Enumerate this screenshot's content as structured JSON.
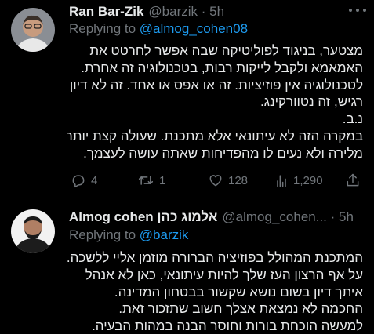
{
  "tweet1": {
    "author_name": "Ran Bar-Zik",
    "author_handle": "@barzik · 5h",
    "replying_prefix": "Replying to ",
    "replying_to": "@almog_cohen08",
    "lines": [
      "מצטער, בניגוד לפוליטיקה שבה אפשר לחרטט את",
      "האמאמא ולקבל לייקות רבות, בטכנולוגיה זה אחרת.",
      "לטכנולוגיה אין פוזיציות. זה או אפס או אחד. זה לא דיון",
      "רגיש, זה נטוורקינג.",
      "נ.ב.",
      "במקרה הזה לא עיתונאי אלא מתכנת. שעולה קצת יותר",
      "מלירה ולא נעים לו מהפדיחות שאתה עושה לעצמך."
    ],
    "actions": {
      "replies": "4",
      "retweets": "1",
      "likes": "128",
      "views": "1,290"
    }
  },
  "tweet2": {
    "author_name": "Almog cohen אלמוג כהן",
    "author_handle": "@almog_cohen... · 5h",
    "replying_prefix": "Replying to ",
    "replying_to": "@barzik",
    "lines": [
      "המתכנת המהולל בפוזיציה הברורה מוזמן אליי ללשכה.",
      "על אף הרצון העז שלך להיות עיתונאי, כאן לא אנהל",
      "איתך דיון בשום נושא שקשור בבטחון המדינה.",
      "החכמה לא נמצאת אצלך חשוב שתזכור זאת.",
      "למעשה הוכחת בורות וחוסר הבנה במהות הבעיה."
    ]
  },
  "icons": [
    "avatar",
    "more-icon",
    "reply-icon",
    "retweet-icon",
    "like-icon",
    "views-icon",
    "share-icon"
  ],
  "colors": {
    "background": "#000000",
    "text": "#e7e9ea",
    "secondary": "#71767b",
    "link": "#1d9bf0",
    "divider": "#2f3336"
  }
}
